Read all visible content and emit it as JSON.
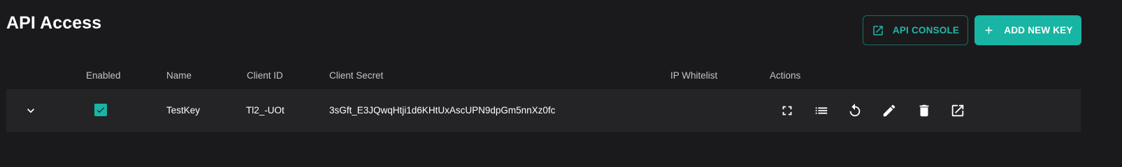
{
  "page": {
    "title": "API Access"
  },
  "toolbar": {
    "console_label": "API CONSOLE",
    "add_key_label": "ADD NEW KEY"
  },
  "table": {
    "columns": [
      "Enabled",
      "Name",
      "Client ID",
      "Client Secret",
      "IP Whitelist",
      "Actions"
    ],
    "rows": [
      {
        "enabled": true,
        "name": "TestKey",
        "client_id": "Tl2_-UOt",
        "client_secret": "3sGft_E3JQwqHtji1d6KHtUxAscUPN9dpGm5nnXz0fc",
        "ip_whitelist": ""
      }
    ],
    "action_icons": [
      "fullscreen-icon",
      "list-icon",
      "reset-icon",
      "edit-icon",
      "delete-icon",
      "open-in-new-icon"
    ]
  },
  "colors": {
    "background": "#1a1a1d",
    "row_background": "#242427",
    "accent": "#18b5a4"
  }
}
